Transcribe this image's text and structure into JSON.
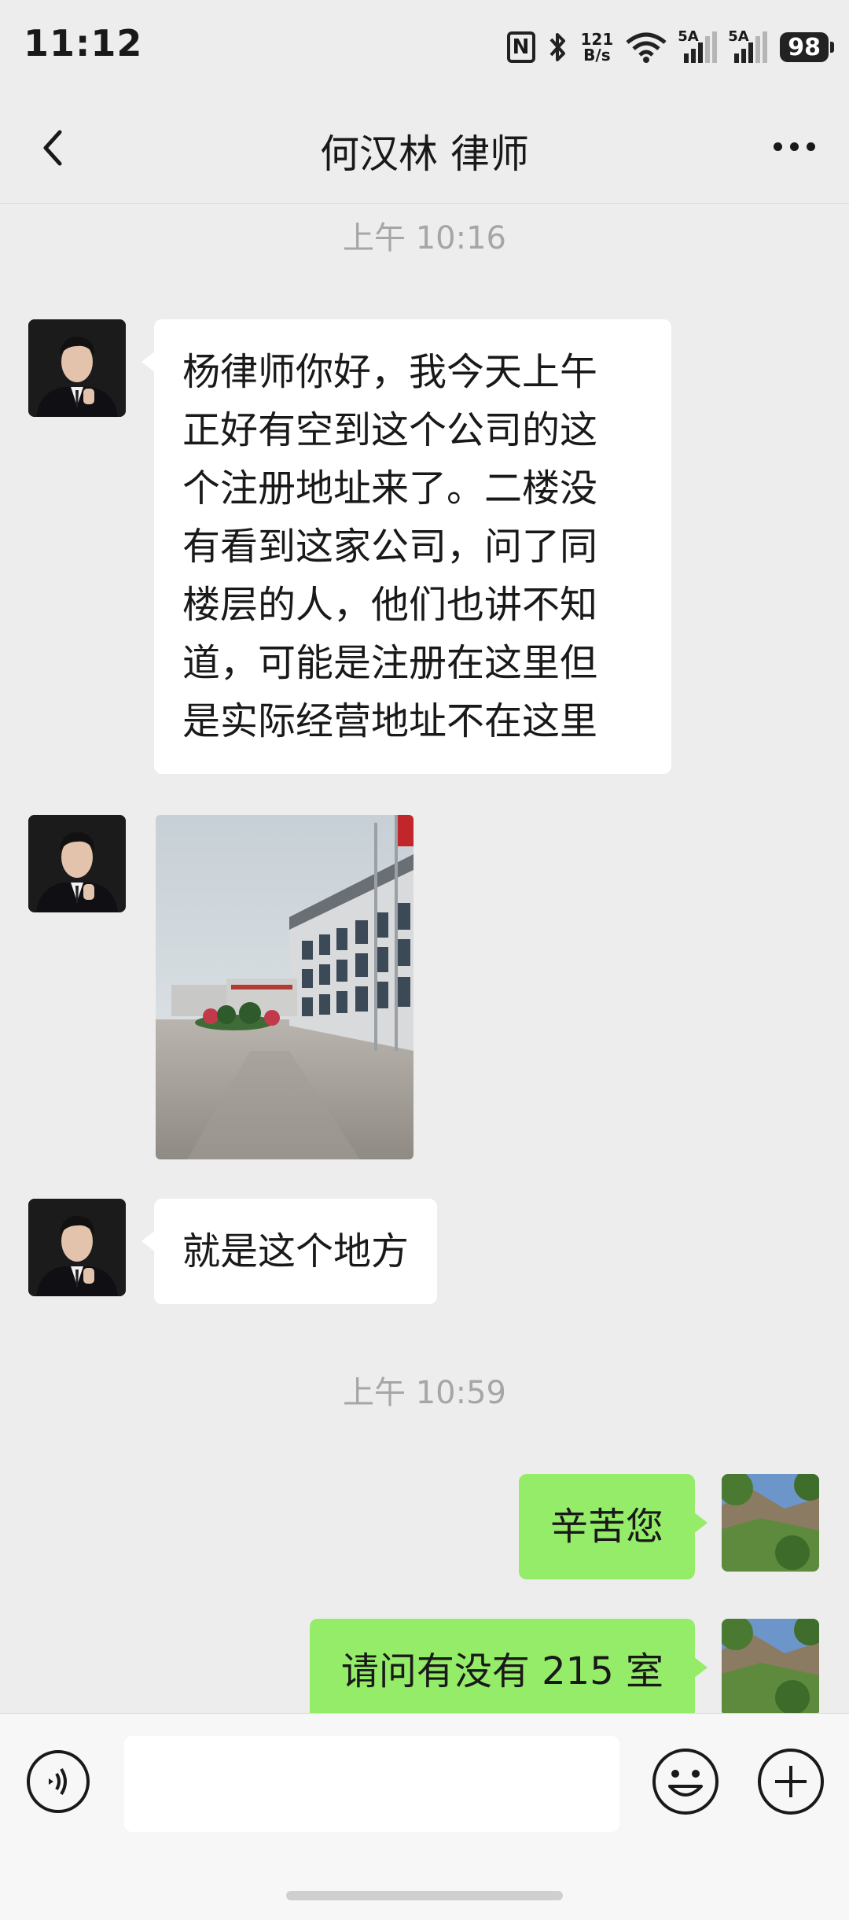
{
  "status_bar": {
    "time": "11:12",
    "nfc_label": "N",
    "net_speed_top": "121",
    "net_speed_bottom": "B/s",
    "sim1_label": "5A",
    "sim2_label": "5A",
    "battery": "98",
    "icons": [
      "nfc-icon",
      "bluetooth-icon",
      "wifi-icon",
      "signal-icon",
      "battery-icon"
    ]
  },
  "chat_header": {
    "title": "何汉林 律师",
    "back_icon": "chevron-left-icon",
    "more_icon": "more-dots-icon"
  },
  "timestamps": [
    "上午 10:16",
    "上午 10:59"
  ],
  "messages": [
    {
      "sender": "lawyer",
      "type": "text",
      "lines": [
        "杨律师你好，我今天上午",
        "正好有空到这个公司的这",
        "个注册地址来了。二楼没",
        "有看到这家公司，问了同",
        "楼层的人，他们也讲不知",
        "道，可能是注册在这里但",
        "是实际经营地址不在这里"
      ]
    },
    {
      "sender": "lawyer",
      "type": "image"
    },
    {
      "sender": "lawyer",
      "type": "text",
      "text": "就是这个地方"
    },
    {
      "sender": "me",
      "type": "text",
      "text": "辛苦您"
    },
    {
      "sender": "me",
      "type": "text",
      "text": "请问有没有 215 室"
    }
  ],
  "input_bar": {
    "voice_icon": "voice-icon",
    "emoji_icon": "emoji-icon",
    "plus_icon": "plus-icon",
    "input_value": ""
  },
  "colors": {
    "background": "#ededed",
    "my_bubble": "#95ec69",
    "their_bubble": "#ffffff",
    "timestamp": "#a6a6a6"
  }
}
